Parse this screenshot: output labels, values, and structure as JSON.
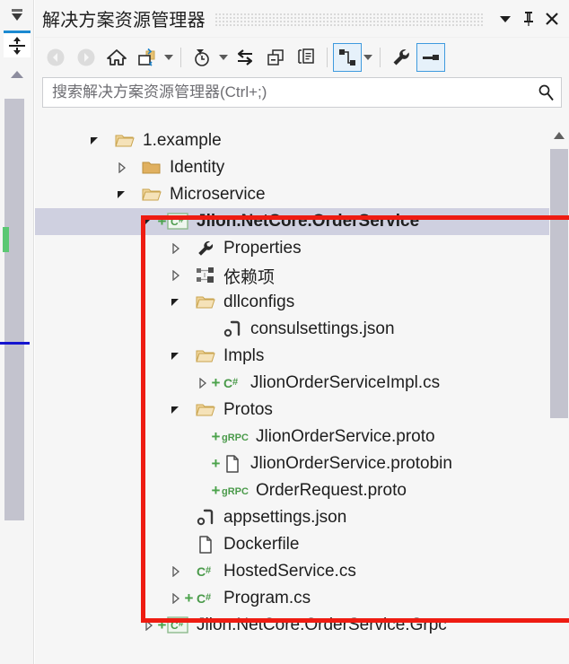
{
  "window": {
    "title": "解决方案资源管理器",
    "dropdown_icon": "chevron-down-icon",
    "pin_icon": "pin-icon",
    "close_icon": "close-icon"
  },
  "dock": {
    "autohide_icon": "auto-hide-icon",
    "split_icon": "split-vertical-icon",
    "scroll_up_icon": "scroll-up-arrow-icon"
  },
  "toolbar": {
    "items": [
      {
        "name": "back-button",
        "icon": "back-arrow-icon",
        "disabled": true,
        "caret": false,
        "active": false
      },
      {
        "name": "forward-button",
        "icon": "forward-arrow-icon",
        "disabled": true,
        "caret": false,
        "active": false
      },
      {
        "name": "home-button",
        "icon": "home-icon",
        "disabled": false,
        "caret": false,
        "active": false
      },
      {
        "name": "sync-with-active-document-button",
        "icon": "sync-folder-icon",
        "disabled": false,
        "caret": true,
        "active": false
      },
      {
        "name": "pending-changes-filter-button",
        "icon": "clock-filter-icon",
        "disabled": false,
        "caret": true,
        "active": false
      },
      {
        "name": "refresh-button",
        "icon": "refresh-arrows-icon",
        "disabled": false,
        "caret": false,
        "active": false
      },
      {
        "name": "collapse-all-button",
        "icon": "collapse-all-icon",
        "disabled": false,
        "caret": false,
        "active": false
      },
      {
        "name": "show-all-files-button",
        "icon": "show-all-files-icon",
        "disabled": false,
        "caret": false,
        "active": false
      },
      {
        "name": "view-class-hierarchy-button",
        "icon": "class-hierarchy-icon",
        "disabled": false,
        "caret": true,
        "active": true
      },
      {
        "name": "properties-button",
        "icon": "wrench-icon",
        "disabled": false,
        "caret": false,
        "active": false
      },
      {
        "name": "preview-selected-items-button",
        "icon": "preview-pane-icon",
        "disabled": false,
        "caret": false,
        "active": true
      }
    ]
  },
  "search": {
    "placeholder": "搜索解决方案资源管理器(Ctrl+;)",
    "value": "",
    "icon": "search-icon"
  },
  "tree": {
    "rows": [
      {
        "label": "1.example",
        "indent": 0,
        "arrow": "expanded",
        "icon": "folder-open-icon",
        "plus": false,
        "selected": false
      },
      {
        "label": "Identity",
        "indent": 1,
        "arrow": "collapsed",
        "icon": "folder-icon",
        "plus": false,
        "selected": false
      },
      {
        "label": "Microservice",
        "indent": 1,
        "arrow": "expanded",
        "icon": "folder-open-icon",
        "plus": false,
        "selected": false
      },
      {
        "label": "Jlion.NetCore.OrderService",
        "indent": 2,
        "arrow": "expanded",
        "icon": "csharp-project-icon",
        "plus": true,
        "selected": true
      },
      {
        "label": "Properties",
        "indent": 3,
        "arrow": "collapsed",
        "icon": "wrench-icon",
        "plus": false,
        "selected": false
      },
      {
        "label": "依赖项",
        "indent": 3,
        "arrow": "collapsed",
        "icon": "dependencies-icon",
        "plus": false,
        "selected": false
      },
      {
        "label": "dllconfigs",
        "indent": 3,
        "arrow": "expanded",
        "icon": "folder-open-icon",
        "plus": false,
        "selected": false
      },
      {
        "label": "consulsettings.json",
        "indent": 4,
        "arrow": "none",
        "icon": "json-file-icon",
        "plus": false,
        "selected": false
      },
      {
        "label": "Impls",
        "indent": 3,
        "arrow": "expanded",
        "icon": "folder-open-icon",
        "plus": false,
        "selected": false
      },
      {
        "label": "JlionOrderServiceImpl.cs",
        "indent": 4,
        "arrow": "collapsed",
        "icon": "csharp-file-icon",
        "plus": true,
        "selected": false
      },
      {
        "label": "Protos",
        "indent": 3,
        "arrow": "expanded",
        "icon": "folder-open-icon",
        "plus": false,
        "selected": false
      },
      {
        "label": "JlionOrderService.proto",
        "indent": 4,
        "arrow": "none",
        "icon": "grpc-file-icon",
        "plus": true,
        "selected": false
      },
      {
        "label": "JlionOrderService.protobin",
        "indent": 4,
        "arrow": "none",
        "icon": "generic-file-icon",
        "plus": true,
        "selected": false
      },
      {
        "label": "OrderRequest.proto",
        "indent": 4,
        "arrow": "none",
        "icon": "grpc-file-icon",
        "plus": true,
        "selected": false
      },
      {
        "label": "appsettings.json",
        "indent": 3,
        "arrow": "none",
        "icon": "json-file-icon",
        "plus": false,
        "selected": false
      },
      {
        "label": "Dockerfile",
        "indent": 3,
        "arrow": "none",
        "icon": "generic-file-icon",
        "plus": false,
        "selected": false
      },
      {
        "label": "HostedService.cs",
        "indent": 3,
        "arrow": "collapsed",
        "icon": "csharp-file-icon",
        "plus": false,
        "selected": false
      },
      {
        "label": "Program.cs",
        "indent": 3,
        "arrow": "collapsed",
        "icon": "csharp-file-icon",
        "plus": true,
        "selected": false
      },
      {
        "label": "Jlion.NetCore.OrderService.Grpc",
        "indent": 2,
        "arrow": "collapsed",
        "icon": "csharp-project-icon",
        "plus": true,
        "selected": false
      }
    ]
  },
  "annotation": {
    "name": "red-highlight-box",
    "color": "#ee1c12"
  },
  "colors": {
    "selection": "#cfd0e0",
    "accent_blue": "#3f9ade",
    "panel_bg": "#f6f6f6",
    "folder": "#e8c170",
    "csharp_green": "#4a9a4a",
    "annotation_red": "#ee1c12"
  }
}
